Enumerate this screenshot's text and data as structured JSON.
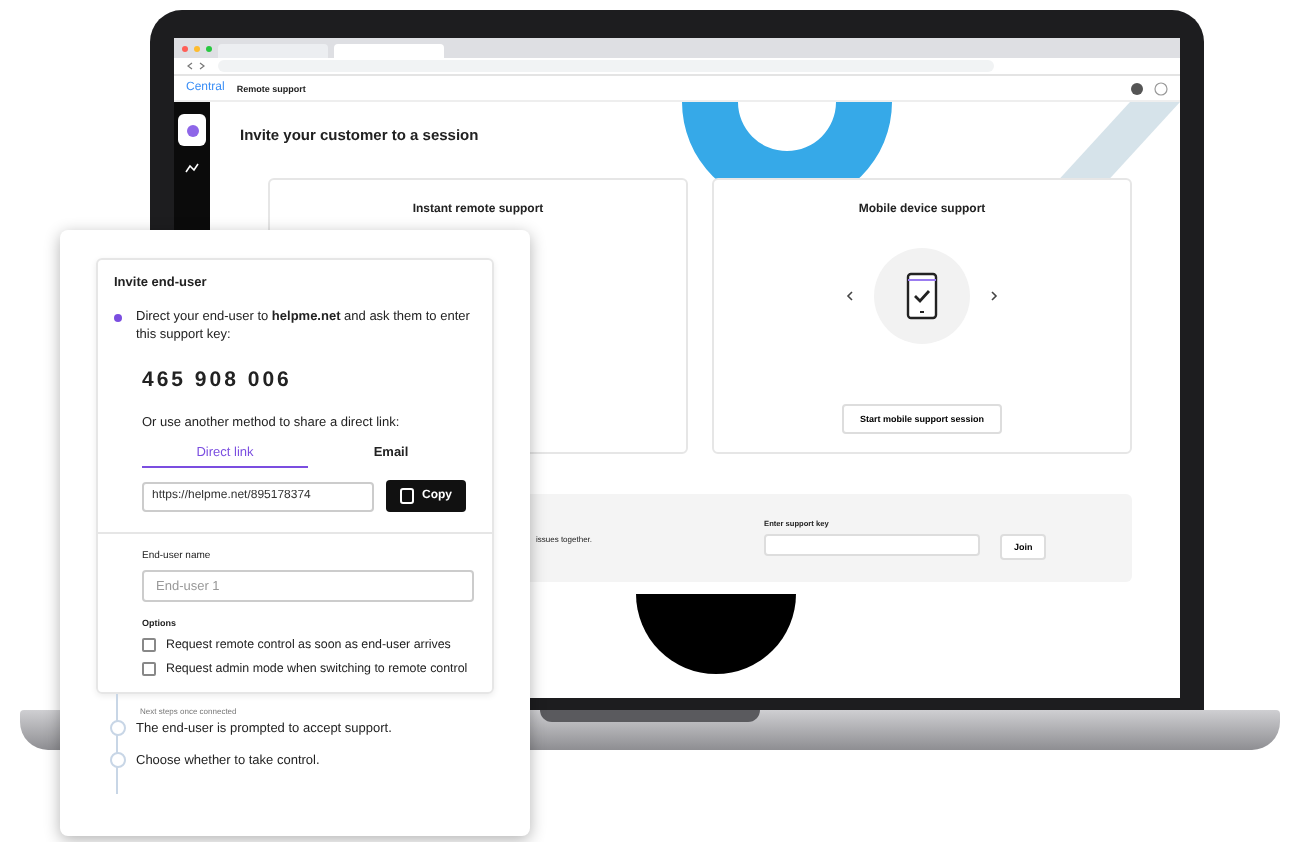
{
  "app_header": {
    "logo": "Central",
    "section": "Remote support"
  },
  "main": {
    "title": "Invite your customer to a session",
    "cards": [
      {
        "kind": "instant",
        "title": "Instant remote support"
      },
      {
        "kind": "mobile",
        "title": "Mobile device support",
        "button": "Start mobile support session"
      }
    ],
    "join_bar": {
      "text": "issues together.",
      "key_label": "Enter support key",
      "join_button": "Join"
    }
  },
  "invite_panel": {
    "title": "Invite end-user",
    "instruction": "Direct your end-user to **helpme.net** and ask them to enter this support key:",
    "support_key": "465 908 006",
    "share_prompt": "Or use another method to share a direct link:",
    "tabs": [
      {
        "label": "Direct link",
        "selected": true
      },
      {
        "label": "Email",
        "selected": false
      }
    ],
    "link_value": "https://helpme.net/895178374",
    "copy_button": "Copy",
    "name_label": "End-user name",
    "name_placeholder": "End-user 1",
    "options_label": "Options",
    "options": [
      {
        "label": "Request remote control as soon as end-user arrives",
        "checked": false
      },
      {
        "label": "Request admin mode when switching to remote control",
        "checked": false
      }
    ],
    "next_steps_label": "Next steps once connected",
    "steps": [
      "The end-user is prompted to accept support.",
      "Choose whether to take control."
    ]
  }
}
